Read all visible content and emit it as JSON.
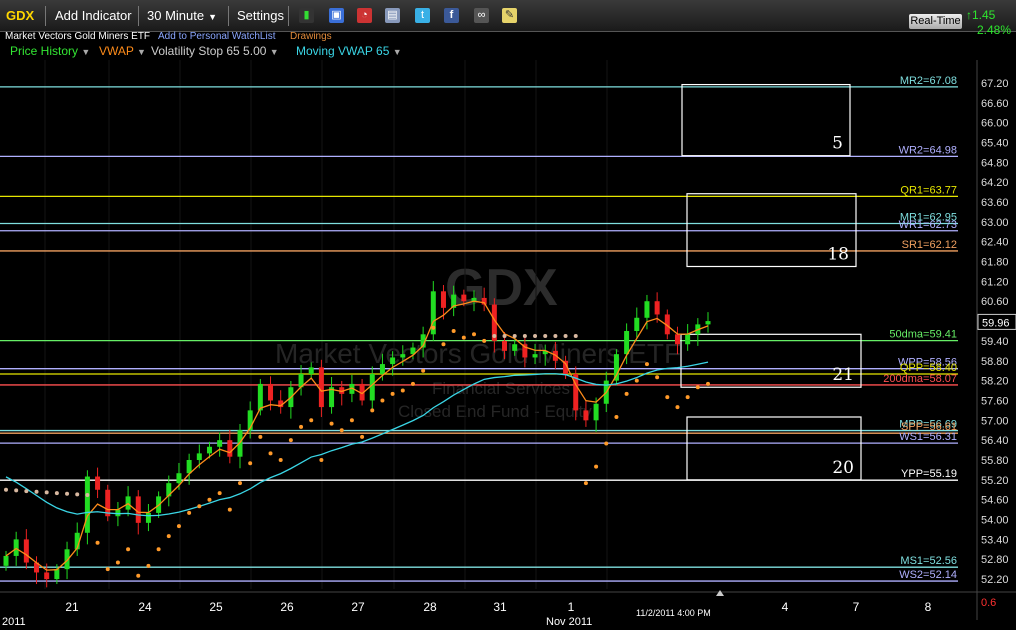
{
  "toolbar": {
    "symbol": "GDX",
    "add_indicator": "Add Indicator",
    "timeframe": "30 Minute",
    "settings": "Settings",
    "realtime": "Real-Time",
    "change": "1.45",
    "change_pct": "2.48%"
  },
  "subheader": {
    "name": "Market Vectors Gold Miners ETF",
    "watchlist": "Add to Personal WatchList",
    "drawings": "Drawings"
  },
  "indicators": [
    {
      "label": "Price History",
      "color": "#33e633"
    },
    {
      "label": "VWAP",
      "color": "#ff8c1a"
    },
    {
      "label": "Volatility Stop 65 5.00",
      "color": "#cccccc"
    },
    {
      "label": "Moving VWAP 65",
      "color": "#3ad6e6"
    }
  ],
  "watermark": {
    "symbol": "GDX",
    "name": "Market Vectors Gold Miners ETF",
    "sector": "Financial Services",
    "type": "Closed End Fund - Equity"
  },
  "colors": {
    "up": "#22dd22",
    "down": "#ee2222",
    "vwap": "#ff8c1a",
    "mvwap": "#3ad6e6",
    "vstop_up": "#ff9a2a",
    "vstop_down": "#d8b8a0"
  },
  "chart_data": {
    "type": "candlestick",
    "y_ticks": [
      "67.20",
      "66.60",
      "66.00",
      "65.40",
      "64.80",
      "64.20",
      "63.60",
      "63.00",
      "62.40",
      "61.80",
      "61.20",
      "60.60",
      "60.00",
      "59.40",
      "58.80",
      "58.20",
      "57.60",
      "57.00",
      "56.40",
      "55.80",
      "55.20",
      "54.60",
      "54.00",
      "53.40",
      "52.80",
      "52.20",
      "0.6"
    ],
    "ylim": [
      51.9,
      67.5
    ],
    "x_labels": [
      "21",
      "24",
      "25",
      "26",
      "27",
      "28",
      "31",
      "1",
      "4",
      "7",
      "8"
    ],
    "x_sublabels": [
      "2011",
      "Nov 2011"
    ],
    "cursor_label": "11/2/2011 4:00 PM",
    "last_price": "59.96",
    "levels": [
      {
        "label": "MR2=67.08",
        "value": 67.08,
        "color": "#7fdfdf"
      },
      {
        "label": "WR2=64.98",
        "value": 64.98,
        "color": "#b0b0ff"
      },
      {
        "label": "QR1=63.77",
        "value": 63.77,
        "color": "#e6e600"
      },
      {
        "label": "MR1=62.95",
        "value": 62.95,
        "color": "#7fdfdf"
      },
      {
        "label": "WR1=62.73",
        "value": 62.73,
        "color": "#b0b0ff"
      },
      {
        "label": "SR1=62.12",
        "value": 62.12,
        "color": "#f0a060"
      },
      {
        "label": "50dma=59.41",
        "value": 59.41,
        "color": "#66ee66"
      },
      {
        "label": "WPP=58.56",
        "value": 58.56,
        "color": "#b0b0ff"
      },
      {
        "label": "QPP=58.40",
        "value": 58.4,
        "color": "#e6e600"
      },
      {
        "label": "200dma=58.07",
        "value": 58.07,
        "color": "#ff5050"
      },
      {
        "label": "MPP=56.69",
        "value": 56.69,
        "color": "#7fdfdf"
      },
      {
        "label": "SPP=56.61",
        "value": 56.61,
        "color": "#f0a060"
      },
      {
        "label": "WS1=56.31",
        "value": 56.31,
        "color": "#b0b0ff"
      },
      {
        "label": "YPP=55.19",
        "value": 55.19,
        "color": "#ffffff"
      },
      {
        "label": "MS1=52.56",
        "value": 52.56,
        "color": "#7fdfdf"
      },
      {
        "label": "WS2=52.14",
        "value": 52.14,
        "color": "#b0b0ff"
      }
    ],
    "boxes": [
      {
        "label": "5",
        "top": 67.15,
        "bottom": 65.0
      },
      {
        "label": "18",
        "top": 63.85,
        "bottom": 61.65
      },
      {
        "label": "21",
        "top": 59.6,
        "bottom": 58.0
      },
      {
        "label": "20",
        "top": 57.1,
        "bottom": 55.2
      }
    ],
    "close": [
      52.9,
      53.4,
      52.7,
      52.4,
      52.2,
      52.5,
      53.1,
      53.6,
      55.3,
      54.9,
      54.1,
      54.3,
      54.7,
      53.9,
      54.2,
      54.7,
      55.1,
      55.4,
      55.8,
      56.0,
      56.2,
      56.4,
      55.9,
      56.7,
      57.3,
      58.1,
      57.6,
      57.4,
      58.0,
      58.4,
      58.6,
      57.4,
      58.0,
      57.8,
      58.1,
      57.6,
      58.4,
      58.7,
      58.9,
      59.0,
      59.2,
      59.6,
      60.9,
      60.4,
      60.8,
      60.6,
      60.7,
      60.5,
      59.4,
      59.1,
      59.3,
      58.9,
      59.0,
      59.1,
      58.8,
      58.4,
      57.3,
      57.0,
      57.5,
      58.2,
      59.0,
      59.7,
      60.1,
      60.6,
      60.2,
      59.6,
      59.3,
      59.6,
      59.9,
      60.0
    ]
  }
}
